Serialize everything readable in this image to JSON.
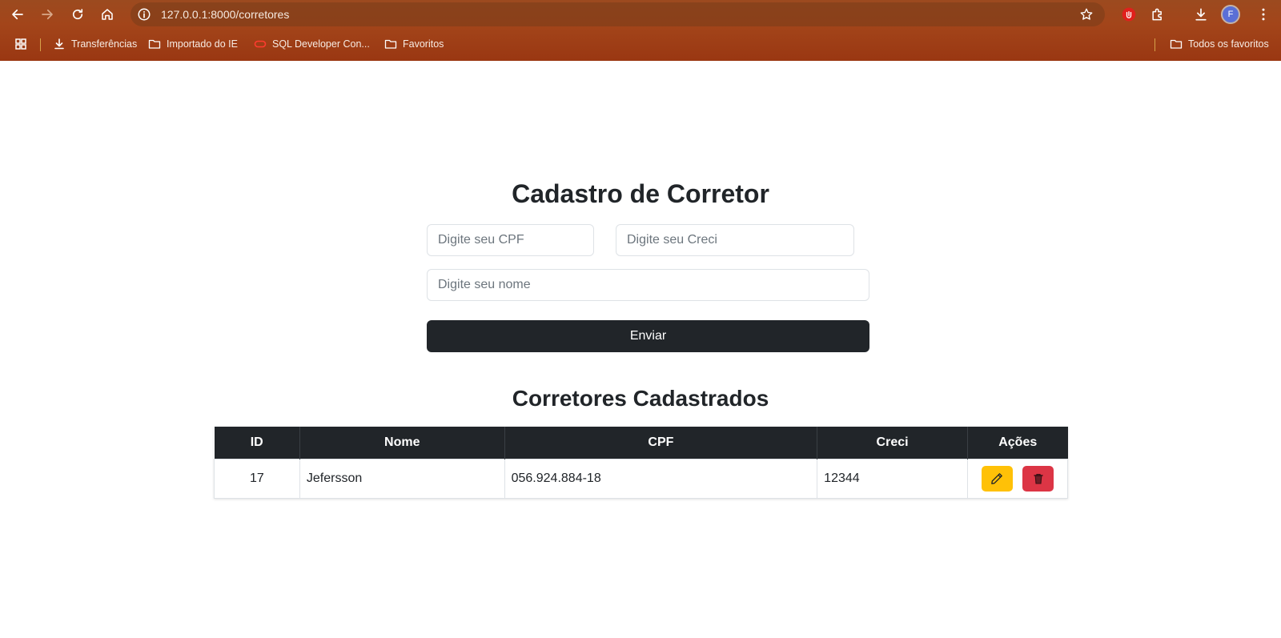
{
  "browser": {
    "url": "127.0.0.1:8000/corretores",
    "avatar_letter": "F",
    "bookmarks": [
      {
        "label": "Transferências",
        "icon": "download-icon"
      },
      {
        "label": "Importado do IE",
        "icon": "folder-icon"
      },
      {
        "label": "SQL Developer Con...",
        "icon": "oracle-icon"
      },
      {
        "label": "Favoritos",
        "icon": "folder-icon"
      }
    ],
    "all_bookmarks": "Todos os favoritos"
  },
  "form": {
    "title": "Cadastro de Corretor",
    "cpf_placeholder": "Digite seu CPF",
    "creci_placeholder": "Digite seu Creci",
    "nome_placeholder": "Digite seu nome",
    "submit_label": "Enviar"
  },
  "list": {
    "title": "Corretores Cadastrados",
    "columns": [
      "ID",
      "Nome",
      "CPF",
      "Creci",
      "Ações"
    ],
    "rows": [
      {
        "id": "17",
        "nome": "Jefersson",
        "cpf": "056.924.884-18",
        "creci": "12344"
      }
    ]
  },
  "colors": {
    "chrome_bg": "#a3451a",
    "dark": "#212529",
    "edit_button": "#ffc107",
    "delete_button": "#dc3545"
  }
}
